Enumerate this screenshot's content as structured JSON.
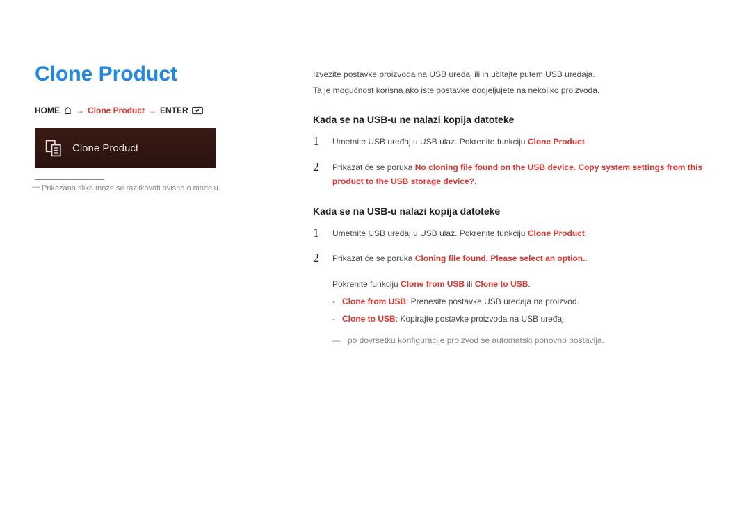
{
  "title": "Clone Product",
  "breadcrumb": {
    "home": "HOME",
    "arrow": "→",
    "item": "Clone Product",
    "enter": "ENTER"
  },
  "tile_label": "Clone Product",
  "left_footnote": "Prikazana slika može se razlikovati ovisno o modelu.",
  "intro": {
    "line1": "Izvezite postavke proizvoda na USB uređaj ili ih učitajte putem USB uređaja.",
    "line2": "Ta je mogućnost korisna ako iste postavke dodjeljujete na nekoliko proizvoda."
  },
  "section1": {
    "heading": "Kada se na USB-u ne nalazi kopija datoteke",
    "step1_pre": "Umetnite USB uređaj u USB ulaz. Pokrenite funkciju ",
    "step1_bold": "Clone Product",
    "step1_post": ".",
    "step2_pre": "Prikazat će se poruka ",
    "step2_bold": "No cloning file found on the USB device. Copy system settings from this product to the USB storage device?",
    "step2_post": "."
  },
  "section2": {
    "heading": "Kada se na USB-u nalazi kopija datoteke",
    "step1_pre": "Umetnite USB uređaj u USB ulaz. Pokrenite funkciju ",
    "step1_bold": "Clone Product",
    "step1_post": ".",
    "step2_pre": "Prikazat će se poruka ",
    "step2_bold": "Cloning file found. Please select an option.",
    "step2_post": ".",
    "run_pre": "Pokrenite funkciju ",
    "run_opt1": "Clone from USB",
    "run_mid": " ili ",
    "run_opt2": "Clone to USB",
    "run_post": ".",
    "opt1_label": "Clone from USB",
    "opt1_desc": ": Prenesite postavke USB uređaja na proizvod.",
    "opt2_label": "Clone to USB",
    "opt2_desc": ": Kopirajte postavke proizvoda na USB uređaj.",
    "final_note": "po dovršetku konfiguracije proizvod se automatski ponovno postavlja."
  },
  "nums": {
    "one": "1",
    "two": "2"
  }
}
